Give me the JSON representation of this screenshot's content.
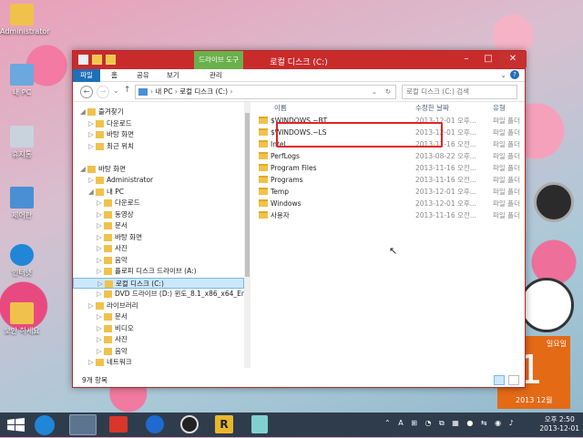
{
  "desktop": {
    "icons": [
      "Administrator",
      "내 PC",
      "휴지통",
      "제어판",
      "인터넷",
      "보안 하세요"
    ]
  },
  "window": {
    "title": "로컬 디스크 (C:)",
    "context_tab": "드라이브 도구",
    "ribbon_tabs": [
      "파일",
      "홈",
      "공유",
      "보기",
      "관리"
    ],
    "address_path": [
      "내 PC",
      "로컬 디스크 (C:)"
    ],
    "search_placeholder": "로컬 디스크 (C:) 검색",
    "status_text": "9개 항목"
  },
  "nav": [
    {
      "label": "즐겨찾기",
      "level": 0,
      "expanded": true
    },
    {
      "label": "다운로드",
      "level": 1
    },
    {
      "label": "바탕 화면",
      "level": 1
    },
    {
      "label": "최근 위치",
      "level": 1
    },
    {
      "label": "",
      "level": 0,
      "spacer": true
    },
    {
      "label": "바탕 화면",
      "level": 0,
      "expanded": true
    },
    {
      "label": "Administrator",
      "level": 1
    },
    {
      "label": "내 PC",
      "level": 1,
      "expanded": true
    },
    {
      "label": "다운로드",
      "level": 2
    },
    {
      "label": "동영상",
      "level": 2
    },
    {
      "label": "문서",
      "level": 2
    },
    {
      "label": "바탕 화면",
      "level": 2
    },
    {
      "label": "사진",
      "level": 2
    },
    {
      "label": "음악",
      "level": 2
    },
    {
      "label": "플로피 디스크 드라이브 (A:)",
      "level": 2
    },
    {
      "label": "로컬 디스크 (C:)",
      "level": 2,
      "selected": true
    },
    {
      "label": "DVD 드라이브 (D:) 윈도_8.1_x86_x64_Enter",
      "level": 2
    },
    {
      "label": "라이브러리",
      "level": 1
    },
    {
      "label": "문서",
      "level": 2
    },
    {
      "label": "비디오",
      "level": 2
    },
    {
      "label": "사진",
      "level": 2
    },
    {
      "label": "음악",
      "level": 2
    },
    {
      "label": "네트워크",
      "level": 1
    }
  ],
  "columns": {
    "name": "이름",
    "date": "수정한 날짜",
    "type": "유형"
  },
  "files": [
    {
      "name": "$WINDOWS.~BT",
      "date": "2013-12-01 오후...",
      "type": "파일 폴더",
      "dim": true
    },
    {
      "name": "$WINDOWS.~LS",
      "date": "2013-12-01 오후...",
      "type": "파일 폴더",
      "dim": true
    },
    {
      "name": "Intel",
      "date": "2013-11-16 오전...",
      "type": "파일 폴더"
    },
    {
      "name": "PerfLogs",
      "date": "2013-08-22 오후...",
      "type": "파일 폴더"
    },
    {
      "name": "Program Files",
      "date": "2013-11-16 오전...",
      "type": "파일 폴더"
    },
    {
      "name": "Programs",
      "date": "2013-11-16 오전...",
      "type": "파일 폴더"
    },
    {
      "name": "Temp",
      "date": "2013-12-01 오후...",
      "type": "파일 폴더"
    },
    {
      "name": "Windows",
      "date": "2013-12-01 오후...",
      "type": "파일 폴더"
    },
    {
      "name": "사용자",
      "date": "2013-11-16 오전...",
      "type": "파일 폴더"
    }
  ],
  "calendar": {
    "dow": "일요일",
    "day": "1",
    "ym": "2013 12월"
  },
  "clock": {
    "time": "오후 2:50",
    "date": "2013-12-01"
  }
}
